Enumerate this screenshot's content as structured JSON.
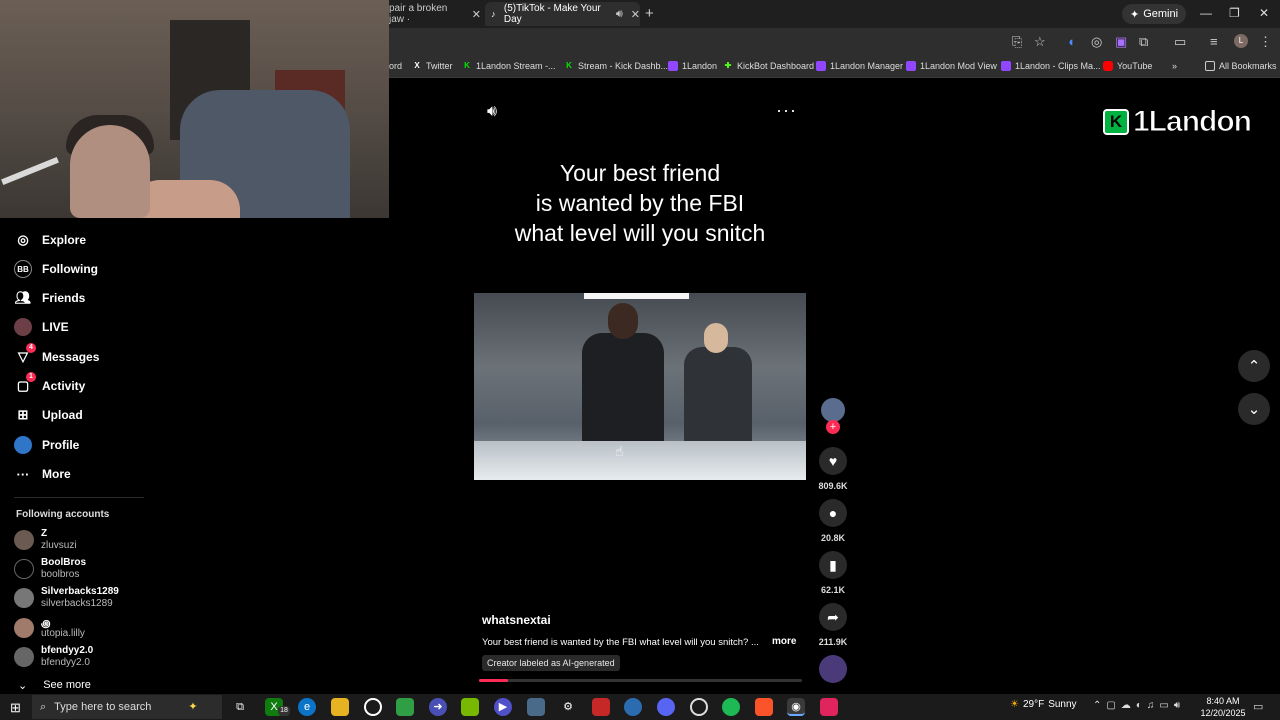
{
  "browser": {
    "tabs": [
      {
        "title": "pair a broken jaw ·",
        "active": false
      },
      {
        "title": "(5)TikTok - Make Your Day",
        "active": true
      }
    ],
    "gemini_label": "Gemini",
    "bookmarks": [
      {
        "label": "ord",
        "icon": "bookmark-fragment"
      },
      {
        "label": "Twitter",
        "icon": "x-icon"
      },
      {
        "label": "1Landon Stream -...",
        "icon": "kick-icon"
      },
      {
        "label": "Stream - Kick Dashb...",
        "icon": "kick-icon"
      },
      {
        "label": "1Landon",
        "icon": "twitch-icon"
      },
      {
        "label": "KickBot Dashboard",
        "icon": "kickbot-icon"
      },
      {
        "label": "1Landon Manager",
        "icon": "twitch-icon"
      },
      {
        "label": "1Landon Mod View",
        "icon": "twitch-icon"
      },
      {
        "label": "1Landon - Clips Ma...",
        "icon": "twitch-icon"
      },
      {
        "label": "YouTube",
        "icon": "youtube-icon"
      }
    ],
    "all_bookmarks": "All Bookmarks"
  },
  "sidebar": {
    "nav": [
      {
        "label": "Explore",
        "icon": "compass-icon",
        "badge": ""
      },
      {
        "label": "Following",
        "icon": "following-icon",
        "badge": ""
      },
      {
        "label": "Friends",
        "icon": "friends-icon",
        "badge": ""
      },
      {
        "label": "LIVE",
        "icon": "live-icon",
        "badge": ""
      },
      {
        "label": "Messages",
        "icon": "messages-icon",
        "badge": "4"
      },
      {
        "label": "Activity",
        "icon": "activity-icon",
        "badge": "1"
      },
      {
        "label": "Upload",
        "icon": "upload-icon",
        "badge": ""
      },
      {
        "label": "Profile",
        "icon": "profile-icon",
        "badge": ""
      },
      {
        "label": "More",
        "icon": "more-icon",
        "badge": ""
      }
    ],
    "following_title": "Following accounts",
    "accounts": [
      {
        "name": "Z",
        "handle": "zluvsuzi"
      },
      {
        "name": "BoolBros",
        "handle": "boolbros"
      },
      {
        "name": "Silverbacks1289",
        "handle": "silverbacks1289"
      },
      {
        "name": "꩜",
        "handle": "utopia.lilly"
      },
      {
        "name": "bfendyy2.0",
        "handle": "bfendyy2.0"
      }
    ],
    "see_more": "See more"
  },
  "video": {
    "headline": [
      "Your best friend",
      "is wanted by the FBI",
      "what level will you snitch"
    ],
    "author": "whatsnextai",
    "description": "Your best friend is wanted by the FBI what level will you snitch? ...",
    "more": "more",
    "ai_label": "Creator labeled as AI-generated",
    "progress": 0.09
  },
  "actions": {
    "likes": "809.6K",
    "comments": "20.8K",
    "saves": "62.1K",
    "shares": "211.9K"
  },
  "overlay": {
    "logo_letter": "K",
    "logo_text": "1Landon"
  },
  "taskbar": {
    "search_placeholder": "Type here to search",
    "weather_temp": "29°F",
    "weather_text": "Sunny",
    "time": "8:40 AM",
    "date": "12/20/2025",
    "xbox_badge": "18"
  },
  "colors": {
    "accent": "#fe2c55",
    "background": "#000000",
    "kick_green": "#00b341"
  }
}
